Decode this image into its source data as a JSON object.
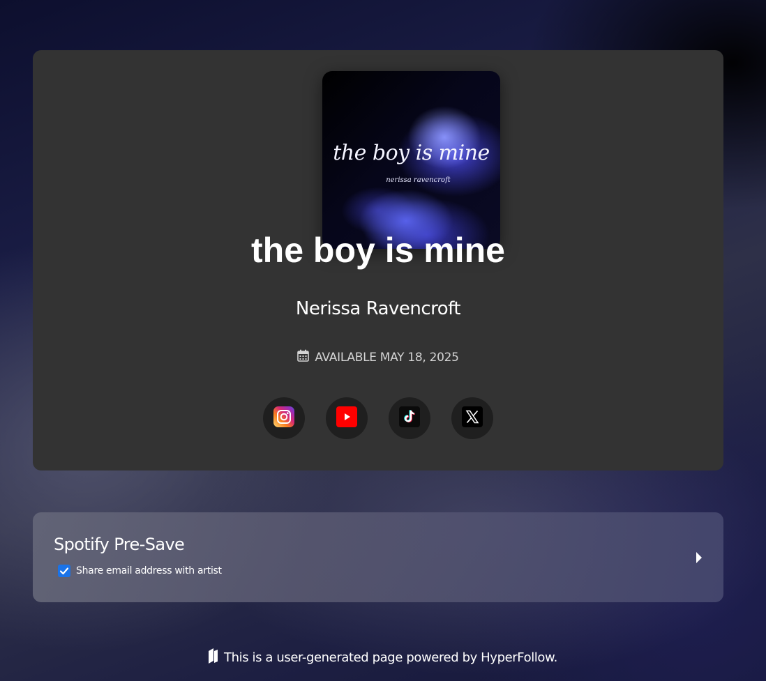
{
  "release": {
    "cover": {
      "title": "the boy is mine",
      "artist": "nerissa ravencroft"
    },
    "title": "the boy is mine",
    "artist": "Nerissa Ravencroft",
    "release_date": "AVAILABLE MAY 18, 2025",
    "socials": [
      {
        "icon": "instagram-icon",
        "color": "#e1306c"
      },
      {
        "icon": "youtube-icon",
        "color": "#ff0000"
      },
      {
        "icon": "tiktok-icon",
        "color": "#000000"
      },
      {
        "icon": "x-icon",
        "color": "#000000"
      }
    ]
  },
  "presave": {
    "title": "Spotify Pre-Save",
    "share_email_label": "Share email address with artist",
    "share_email_checked": true
  },
  "footer": {
    "text": "This is a user-generated page powered by HyperFollow."
  },
  "colors": {
    "card_background": "#333333",
    "social_button_background": "#1f1f1f",
    "checkbox_accent": "#1a73e8"
  }
}
